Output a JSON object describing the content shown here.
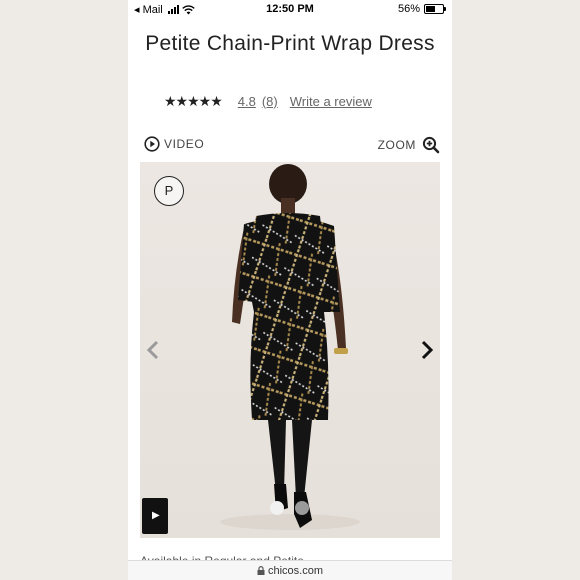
{
  "status_bar": {
    "back_app": "◂ Mail",
    "time": "12:50 PM",
    "battery_percent": "56%",
    "battery_level": 0.56
  },
  "product": {
    "title": "Petite Chain-Print Wrap Dress",
    "stars": "★★★★★",
    "rating": "4.8",
    "review_count": "(8)",
    "write_review": "Write a review"
  },
  "media": {
    "video_label": "VIDEO",
    "zoom_label": "ZOOM",
    "badge_letter": "P"
  },
  "availability_text": "Available in Regular and Petite",
  "url_bar": {
    "domain": "chicos.com"
  },
  "icons": [
    "play-circle-icon",
    "zoom-in-icon",
    "lock-icon",
    "chevron-left-icon",
    "chevron-right-icon",
    "wifi-icon",
    "signal-icon",
    "battery-icon"
  ],
  "colors": {
    "dress_base": "#111111",
    "chain_gold": "#b89b5e",
    "chain_silver": "#cfcfcf",
    "background": "#ebe6e1"
  }
}
